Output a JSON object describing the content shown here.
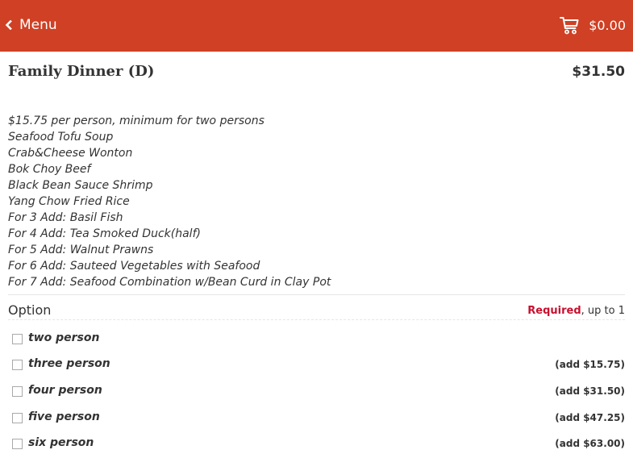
{
  "header": {
    "back_label": "Menu",
    "cart_total": "$0.00",
    "accent_color": "#cf4024",
    "back_icon": "chevron-left-icon",
    "cart_icon": "cart-icon"
  },
  "item": {
    "title": "Family Dinner (D)",
    "price": "$31.50",
    "description": [
      "$15.75 per person, minimum for two persons",
      "Seafood Tofu Soup",
      "Crab&Cheese Wonton",
      "Bok Choy Beef",
      "Black Bean Sauce Shrimp",
      "Yang Chow Fried Rice",
      "For 3 Add: Basil Fish",
      "For 4 Add: Tea Smoked Duck(half)",
      "For 5 Add: Walnut Prawns",
      "For 6 Add: Sauteed Vegetables with Seafood",
      "For 7 Add: Seafood Combination w/Bean Curd in Clay Pot"
    ]
  },
  "option_group": {
    "title": "Option",
    "required_label": "Required",
    "limit_label": ", up to 1",
    "required_color": "#c8102e",
    "options": [
      {
        "label": "two person",
        "price": "",
        "checked": false
      },
      {
        "label": "three person",
        "price": "(add $15.75)",
        "checked": false
      },
      {
        "label": "four person",
        "price": "(add $31.50)",
        "checked": false
      },
      {
        "label": "five person",
        "price": "(add $47.25)",
        "checked": false
      },
      {
        "label": "six person",
        "price": "(add $63.00)",
        "checked": false
      }
    ]
  }
}
